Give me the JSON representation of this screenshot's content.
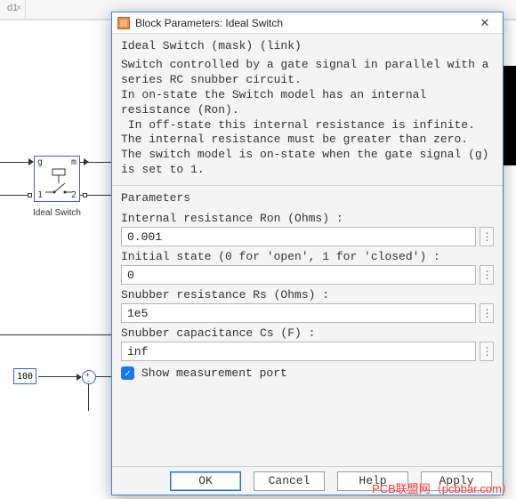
{
  "tab": {
    "label": "d1"
  },
  "canvas": {
    "switch_block_label": "Ideal Switch",
    "switch_ports": {
      "g": "g",
      "m": "m",
      "p1": "1",
      "p2": "2"
    },
    "constant_value": "100"
  },
  "dialog": {
    "title": "Block Parameters: Ideal Switch",
    "mask_line": "Ideal Switch (mask) (link)",
    "help_text": "Switch controlled by a gate signal in parallel with a series RC snubber circuit.\nIn on-state the Switch model has an internal resistance (Ron).\n In off-state this internal resistance is infinite.\nThe internal resistance must be greater than zero.\nThe switch model is on-state when the gate signal (g) is set to 1.",
    "section": "Parameters",
    "fields": {
      "ron": {
        "label": "Internal resistance Ron (Ohms) :",
        "value": "0.001"
      },
      "init": {
        "label": "Initial state (0 for 'open', 1 for 'closed') :",
        "value": "0"
      },
      "rs": {
        "label": "Snubber resistance Rs (Ohms) :",
        "value": "1e5"
      },
      "cs": {
        "label": "Snubber capacitance Cs (F) :",
        "value": "inf"
      }
    },
    "checkbox": {
      "label": "Show measurement port",
      "checked": true
    },
    "buttons": {
      "ok": "OK",
      "cancel": "Cancel",
      "help": "Help",
      "apply": "Apply"
    }
  },
  "watermark": "PCB联盟网（pcbbar.com）"
}
